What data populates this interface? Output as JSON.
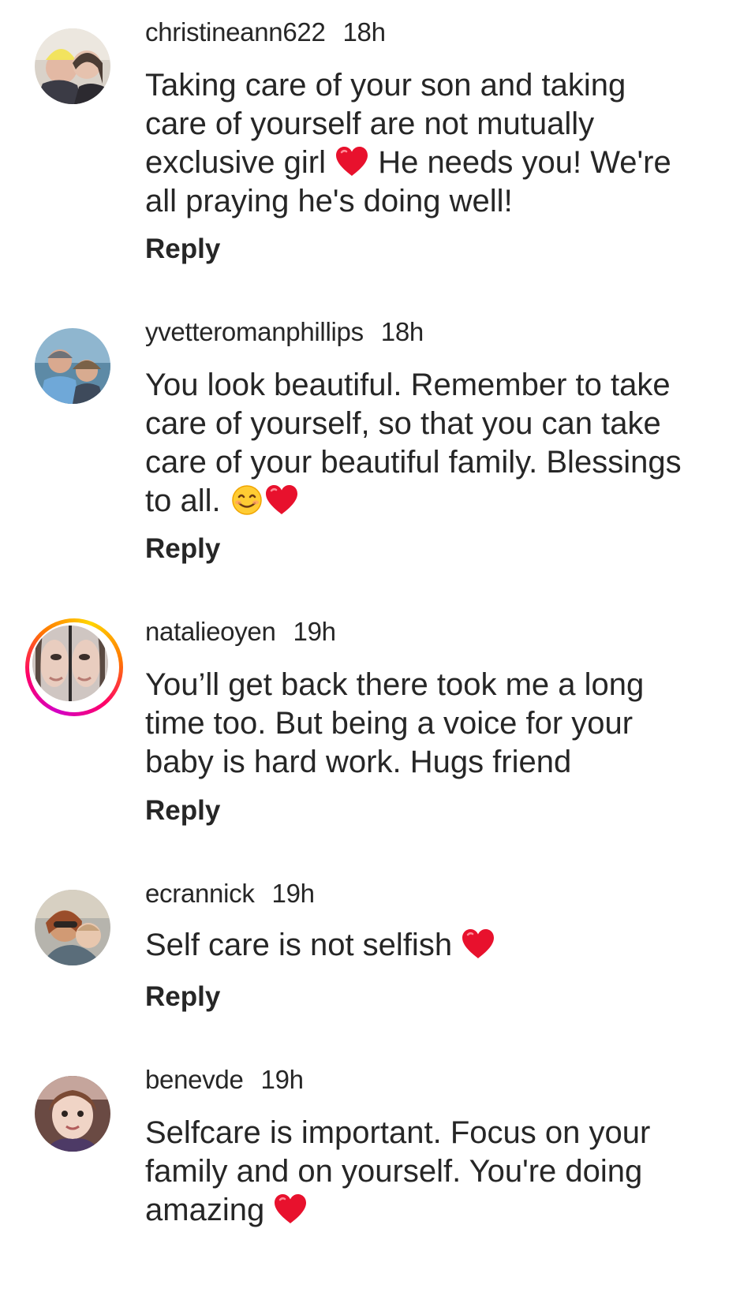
{
  "comments": [
    {
      "username": "christineann622",
      "time": "18h",
      "lines": [
        "Taking care of your son and taking",
        "care of yourself are not mutually",
        [
          "exclusive girl ",
          "heart",
          " He needs you! We're"
        ],
        "all praying he's doing well!"
      ],
      "reply_label": "Reply",
      "avatar_icon": "avatar-photo",
      "has_story_ring": false
    },
    {
      "username": "yvetteromanphillips",
      "time": "18h",
      "lines": [
        "You look beautiful. Remember to take",
        "care of yourself, so that you can take",
        "care of your beautiful family. Blessings",
        [
          "to all. ",
          "smile",
          "heart"
        ]
      ],
      "reply_label": "Reply",
      "avatar_icon": "avatar-photo",
      "has_story_ring": false
    },
    {
      "username": "natalieoyen",
      "time": "19h",
      "lines": [
        "You’ll get back there took me a long",
        "time too. But being a voice for your",
        "baby is hard work. Hugs friend"
      ],
      "reply_label": "Reply",
      "avatar_icon": "avatar-photo",
      "has_story_ring": true
    },
    {
      "username": "ecrannick",
      "time": "19h",
      "lines": [
        [
          "Self care is not selfish ",
          "heart"
        ]
      ],
      "reply_label": "Reply",
      "avatar_icon": "avatar-photo",
      "has_story_ring": false
    },
    {
      "username": "benevde",
      "time": "19h",
      "lines": [
        "Selfcare is important. Focus on your",
        "family and on yourself. You're doing",
        [
          "amazing ",
          "heart"
        ]
      ],
      "reply_label": "",
      "avatar_icon": "avatar-photo",
      "has_story_ring": false
    }
  ],
  "colors": {
    "text": "#262626",
    "heart": "#e8112d",
    "story_ring": [
      "#d300c5",
      "#ff0069",
      "#ff7a00",
      "#ffd600"
    ]
  }
}
